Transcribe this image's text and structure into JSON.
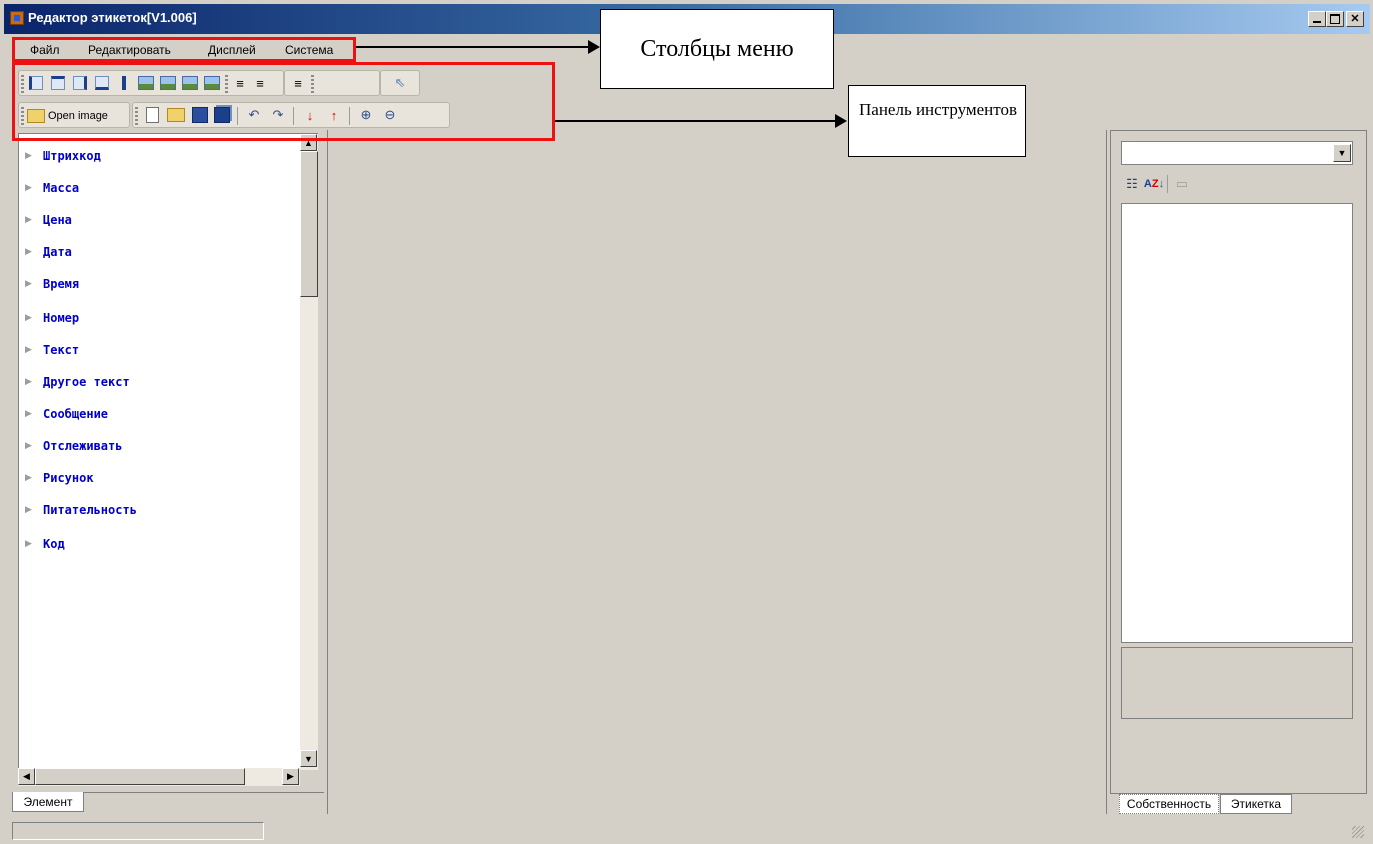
{
  "window": {
    "title": "Редактор этикеток[V1.006]",
    "caption_buttons": [
      "minimize",
      "maximize",
      "close"
    ]
  },
  "menu": {
    "items": [
      "Файл",
      "Редактировать",
      "Дисплей",
      "Система"
    ]
  },
  "toolbar": {
    "row1_icons": [
      "align-left-edge-icon",
      "align-top-edge-icon",
      "align-right-edge-icon",
      "align-bottom-edge-icon",
      "center-vertical-icon",
      "image-icon",
      "image-icon",
      "image-icon",
      "image-icon",
      "text-align-left-icon",
      "text-align-center-icon",
      "text-align-right-icon",
      "pointer-icon"
    ],
    "open_image_label": "Open image",
    "row2_icons": [
      "new-file-icon",
      "open-folder-icon",
      "save-icon",
      "save-as-icon",
      "undo-icon",
      "redo-icon",
      "move-down-icon",
      "move-up-icon",
      "zoom-in-icon",
      "zoom-out-icon"
    ]
  },
  "element_tree": {
    "items": [
      "Штрихкод",
      "Масса",
      "Цена",
      "Дата",
      "Время",
      "Номер",
      "Текст",
      "Другое текст",
      "Сообщение",
      "Отслеживать",
      "Рисунок",
      "Питательность",
      "Код"
    ]
  },
  "left_tabs": {
    "element": "Элемент"
  },
  "right_tabs": {
    "property": "Собственность",
    "label": "Этикетка"
  },
  "annotations": {
    "menu_callout": "Столбцы меню",
    "toolbar_callout": "Панель инструментов",
    "highlight_color": "#ee1111"
  }
}
